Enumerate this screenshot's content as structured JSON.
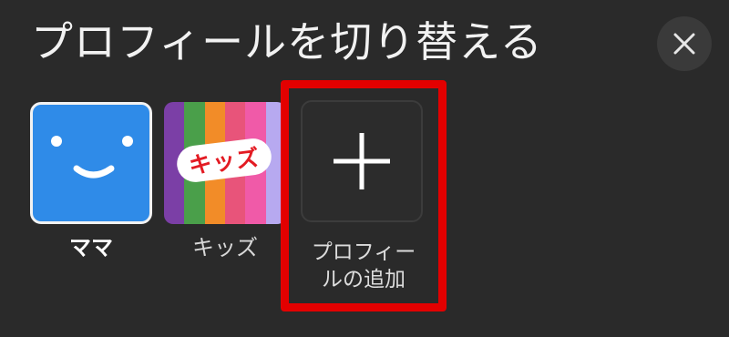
{
  "header": {
    "title": "プロフィールを切り替える"
  },
  "colors": {
    "background": "#2a2a2a",
    "mama_avatar": "#2f8be8",
    "highlight": "#e30000",
    "kids_badge_text": "#e31b23"
  },
  "profiles": [
    {
      "name": "ママ",
      "icon": "smiley-face-icon"
    },
    {
      "name": "キッズ",
      "icon": "kids-logo",
      "badge_text": "キッズ"
    }
  ],
  "add_profile": {
    "label_line1": "プロフィー",
    "label_line2": "ルの追加",
    "icon": "plus-icon"
  },
  "close_icon": "close-icon"
}
